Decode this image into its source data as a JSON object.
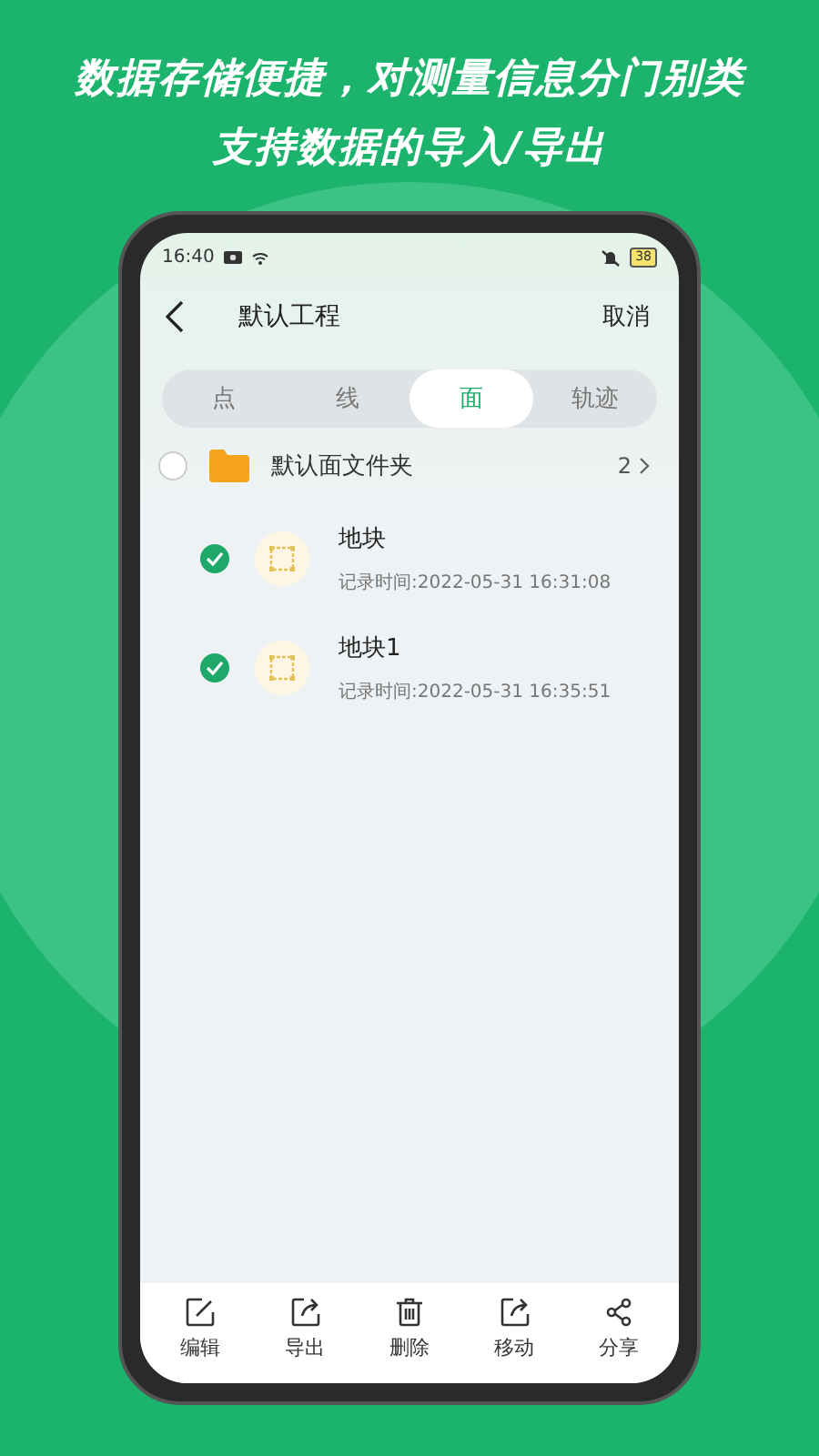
{
  "headline": [
    "数据存储便捷，对测量信息分门别类",
    "支持数据的导入/导出"
  ],
  "status_bar": {
    "time": "16:40",
    "battery": "38"
  },
  "nav": {
    "title": "默认工程",
    "action": "取消"
  },
  "tabs": [
    {
      "label": "点",
      "selected": false
    },
    {
      "label": "线",
      "selected": false
    },
    {
      "label": "面",
      "selected": true
    },
    {
      "label": "轨迹",
      "selected": false
    }
  ],
  "folder": {
    "name": "默认面文件夹",
    "count": "2",
    "checked": false
  },
  "items": [
    {
      "name": "地块",
      "time": "记录时间:2022-05-31 16:31:08",
      "checked": true
    },
    {
      "name": "地块1",
      "time": "记录时间:2022-05-31 16:35:51",
      "checked": true
    }
  ],
  "toolbar": [
    {
      "kind": "edit",
      "label": "编辑"
    },
    {
      "kind": "export",
      "label": "导出"
    },
    {
      "kind": "delete",
      "label": "删除"
    },
    {
      "kind": "move",
      "label": "移动"
    },
    {
      "kind": "share",
      "label": "分享"
    }
  ]
}
